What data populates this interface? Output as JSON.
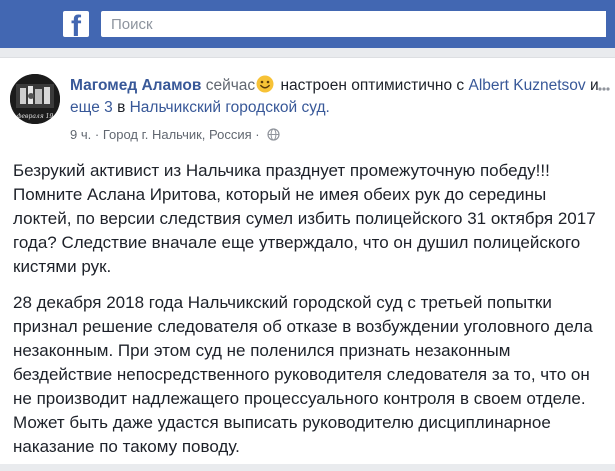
{
  "topbar": {
    "logo_letter": "f",
    "search_placeholder": "Поиск"
  },
  "post": {
    "author": "Магомед Аламов",
    "time_now": "сейчас",
    "feeling": "настроен оптимистично с",
    "tagged_user_1": "Albert",
    "tagged_user_2": "Kuznetsov",
    "and_word": "и",
    "others": "еще 3",
    "in_word": "в",
    "place": "Нальчикский городской суд.",
    "meta_time": "9 ч.",
    "meta_sep": "·",
    "meta_location": "Город г. Нальчик, Россия",
    "meta_sep2": "·",
    "paragraph_1": "Безрукий активист из Нальчика празднует промежуточную победу!!! Помните Аслана Иритова, который не имея обеих рук до середины локтей, по версии следствия сумел избить полицейского 31 октября 2017 года? Следствие вначале еще утверждало, что он душил полицейского кистями рук.",
    "paragraph_2": "28 декабря 2018 года Нальчикский городской суд с третьей попытки признал решение следователя об отказе в возбуждении уголовного дела незаконным. При этом суд не поленился признать незаконным бездействие непосредственного руководителя следователя за то, что он не производит надлежащего процессуального контроля в своем отделе. Может быть даже удастся выписать руководителю дисциплинарное наказание по такому поводу.",
    "avatar_caption": "февраля 19"
  },
  "colors": {
    "brand": "#4267b2",
    "link": "#385898",
    "text": "#1d2129",
    "muted": "#616770",
    "emoji": "#f7c236"
  }
}
